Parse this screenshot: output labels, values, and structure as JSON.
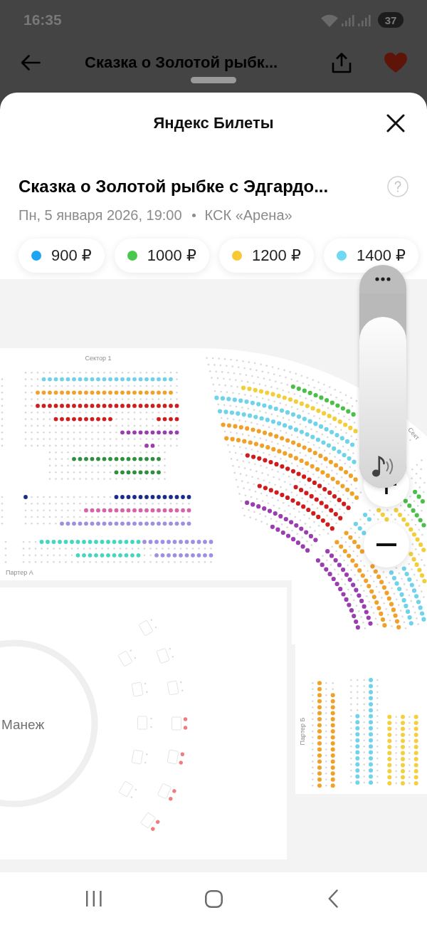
{
  "status_bar": {
    "time": "16:35",
    "battery": "37"
  },
  "app_bar": {
    "title": "Сказка о Золотой рыбк...",
    "favorite": true
  },
  "sheet": {
    "title": "Яндекс Билеты"
  },
  "event": {
    "title": "Сказка о Золотой рыбке с Эдгардо...",
    "date": "Пн, 5 января 2026, 19:00",
    "venue": "КСК «Арена»"
  },
  "prices": [
    {
      "label": "900 ₽",
      "color": "#1ea5f2"
    },
    {
      "label": "1000 ₽",
      "color": "#48c84f"
    },
    {
      "label": "1200 ₽",
      "color": "#f7c934"
    },
    {
      "label": "1400 ₽",
      "color": "#6fd8f2"
    }
  ],
  "seat_map": {
    "sectors": [
      {
        "kind": "grid",
        "label": "Сектор 1",
        "runs": [
          {
            "color": "#72d0ea"
          },
          {
            "color": "#f0a12a"
          },
          {
            "color": "#d01c1c"
          },
          {
            "color": "#d01c1c"
          },
          {
            "color": "#d01c1c"
          },
          {
            "color": "#9a3db0"
          },
          {
            "color": "#9a3db0"
          },
          {
            "color": "#2f8f3f"
          },
          {
            "color": "#2f8f3f"
          }
        ]
      },
      {
        "kind": "grid",
        "runs": [
          {
            "color": "#1b2b8c"
          },
          {
            "color": "#1b2b8c"
          },
          {
            "color": "#d862a8"
          },
          {
            "color": "#9f8fe3"
          }
        ]
      },
      {
        "kind": "grid",
        "label": "Партер А",
        "runs": [
          {
            "color": "#45d6bf"
          },
          {
            "color": "#9f8fe3"
          },
          {
            "color": "#45d6bf"
          },
          {
            "color": "#9f8fe3"
          }
        ]
      },
      {
        "kind": "arc",
        "runs": [
          {
            "color": "#9a3db0"
          },
          {
            "color": "#9a3db0"
          },
          {
            "color": "#d01c1c"
          },
          {
            "color": "#d01c1c"
          },
          {
            "color": "#d01c1c"
          },
          {
            "color": "#f0a12a"
          },
          {
            "color": "#f0a12a"
          },
          {
            "color": "#6fd3ea"
          },
          {
            "color": "#6fd3ea"
          },
          {
            "color": "#f2cf3a"
          },
          {
            "color": "#4cbf4a"
          }
        ]
      },
      {
        "kind": "arc",
        "label": "Сект",
        "runs": [
          {
            "color": "#9a3db0"
          },
          {
            "color": "#9a3db0"
          },
          {
            "color": "#f0a12a"
          },
          {
            "color": "#f0a12a"
          },
          {
            "color": "#6fd3ea"
          },
          {
            "color": "#6fd3ea"
          },
          {
            "color": "#f2cf3a"
          },
          {
            "color": "#f2cf3a"
          },
          {
            "color": "#4cbf4a"
          },
          {
            "color": "#4cbf4a"
          }
        ]
      },
      {
        "kind": "columns",
        "label": "Партер Б",
        "runs": [
          {
            "color": "#f0a12a"
          },
          {
            "color": "#f0a12a"
          },
          {
            "color": "#6fd3ea"
          },
          {
            "color": "#6fd3ea"
          },
          {
            "color": "#f2d040"
          },
          {
            "color": "#f2d040"
          },
          {
            "color": "#f2d040"
          }
        ]
      }
    ],
    "arena": {
      "label": "Манеж"
    },
    "loges": [
      {
        "available": false
      },
      {
        "available": false
      },
      {
        "available": false
      },
      {
        "available": false
      },
      {
        "available": false
      },
      {
        "available": false
      },
      {
        "available": true,
        "color": "#ee7d80"
      },
      {
        "available": false
      },
      {
        "available": true,
        "color": "#ee7d80"
      },
      {
        "available": false
      },
      {
        "available": true,
        "color": "#ee7d80"
      },
      {
        "available": true,
        "color": "#ee7d80"
      }
    ]
  },
  "volume": {
    "level": 0.88
  }
}
